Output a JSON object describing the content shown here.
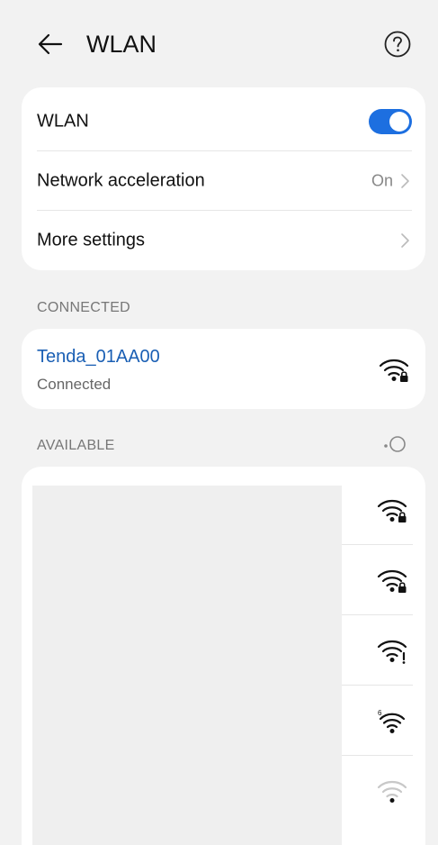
{
  "header": {
    "title": "WLAN",
    "back_icon": "arrow-left-icon",
    "help_icon": "help-circle-icon"
  },
  "settings": {
    "wlan_label": "WLAN",
    "wlan_enabled": true,
    "network_acceleration_label": "Network acceleration",
    "network_acceleration_value": "On",
    "more_settings_label": "More settings"
  },
  "sections": {
    "connected": "CONNECTED",
    "available": "AVAILABLE"
  },
  "connected_network": {
    "name": "Tenda_01AA00",
    "status": "Connected",
    "signal_icon": "wifi-locked-icon"
  },
  "available_networks": [
    {
      "signal_icon": "wifi-locked-icon"
    },
    {
      "signal_icon": "wifi-locked-icon"
    },
    {
      "signal_icon": "wifi-warning-icon"
    },
    {
      "signal_icon": "wifi-6-icon"
    },
    {
      "signal_icon": "wifi-weak-icon"
    }
  ],
  "colors": {
    "accent": "#1d6fe0",
    "network_name": "#1a5fb4",
    "background": "#f2f2f2",
    "card": "#ffffff"
  }
}
